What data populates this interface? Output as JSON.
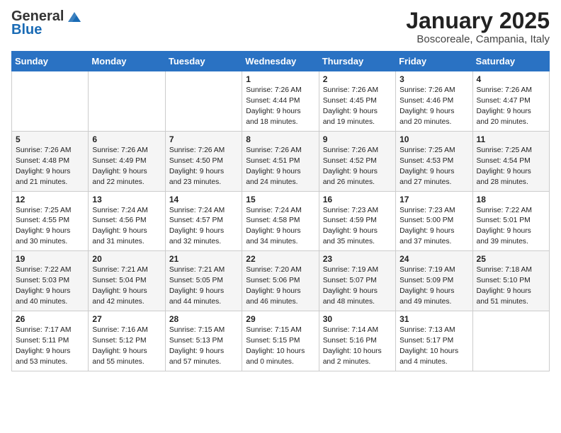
{
  "header": {
    "logo_general": "General",
    "logo_blue": "Blue",
    "month_title": "January 2025",
    "location": "Boscoreale, Campania, Italy"
  },
  "days_of_week": [
    "Sunday",
    "Monday",
    "Tuesday",
    "Wednesday",
    "Thursday",
    "Friday",
    "Saturday"
  ],
  "weeks": [
    [
      {
        "day": "",
        "info": ""
      },
      {
        "day": "",
        "info": ""
      },
      {
        "day": "",
        "info": ""
      },
      {
        "day": "1",
        "info": "Sunrise: 7:26 AM\nSunset: 4:44 PM\nDaylight: 9 hours\nand 18 minutes."
      },
      {
        "day": "2",
        "info": "Sunrise: 7:26 AM\nSunset: 4:45 PM\nDaylight: 9 hours\nand 19 minutes."
      },
      {
        "day": "3",
        "info": "Sunrise: 7:26 AM\nSunset: 4:46 PM\nDaylight: 9 hours\nand 20 minutes."
      },
      {
        "day": "4",
        "info": "Sunrise: 7:26 AM\nSunset: 4:47 PM\nDaylight: 9 hours\nand 20 minutes."
      }
    ],
    [
      {
        "day": "5",
        "info": "Sunrise: 7:26 AM\nSunset: 4:48 PM\nDaylight: 9 hours\nand 21 minutes."
      },
      {
        "day": "6",
        "info": "Sunrise: 7:26 AM\nSunset: 4:49 PM\nDaylight: 9 hours\nand 22 minutes."
      },
      {
        "day": "7",
        "info": "Sunrise: 7:26 AM\nSunset: 4:50 PM\nDaylight: 9 hours\nand 23 minutes."
      },
      {
        "day": "8",
        "info": "Sunrise: 7:26 AM\nSunset: 4:51 PM\nDaylight: 9 hours\nand 24 minutes."
      },
      {
        "day": "9",
        "info": "Sunrise: 7:26 AM\nSunset: 4:52 PM\nDaylight: 9 hours\nand 26 minutes."
      },
      {
        "day": "10",
        "info": "Sunrise: 7:25 AM\nSunset: 4:53 PM\nDaylight: 9 hours\nand 27 minutes."
      },
      {
        "day": "11",
        "info": "Sunrise: 7:25 AM\nSunset: 4:54 PM\nDaylight: 9 hours\nand 28 minutes."
      }
    ],
    [
      {
        "day": "12",
        "info": "Sunrise: 7:25 AM\nSunset: 4:55 PM\nDaylight: 9 hours\nand 30 minutes."
      },
      {
        "day": "13",
        "info": "Sunrise: 7:24 AM\nSunset: 4:56 PM\nDaylight: 9 hours\nand 31 minutes."
      },
      {
        "day": "14",
        "info": "Sunrise: 7:24 AM\nSunset: 4:57 PM\nDaylight: 9 hours\nand 32 minutes."
      },
      {
        "day": "15",
        "info": "Sunrise: 7:24 AM\nSunset: 4:58 PM\nDaylight: 9 hours\nand 34 minutes."
      },
      {
        "day": "16",
        "info": "Sunrise: 7:23 AM\nSunset: 4:59 PM\nDaylight: 9 hours\nand 35 minutes."
      },
      {
        "day": "17",
        "info": "Sunrise: 7:23 AM\nSunset: 5:00 PM\nDaylight: 9 hours\nand 37 minutes."
      },
      {
        "day": "18",
        "info": "Sunrise: 7:22 AM\nSunset: 5:01 PM\nDaylight: 9 hours\nand 39 minutes."
      }
    ],
    [
      {
        "day": "19",
        "info": "Sunrise: 7:22 AM\nSunset: 5:03 PM\nDaylight: 9 hours\nand 40 minutes."
      },
      {
        "day": "20",
        "info": "Sunrise: 7:21 AM\nSunset: 5:04 PM\nDaylight: 9 hours\nand 42 minutes."
      },
      {
        "day": "21",
        "info": "Sunrise: 7:21 AM\nSunset: 5:05 PM\nDaylight: 9 hours\nand 44 minutes."
      },
      {
        "day": "22",
        "info": "Sunrise: 7:20 AM\nSunset: 5:06 PM\nDaylight: 9 hours\nand 46 minutes."
      },
      {
        "day": "23",
        "info": "Sunrise: 7:19 AM\nSunset: 5:07 PM\nDaylight: 9 hours\nand 48 minutes."
      },
      {
        "day": "24",
        "info": "Sunrise: 7:19 AM\nSunset: 5:09 PM\nDaylight: 9 hours\nand 49 minutes."
      },
      {
        "day": "25",
        "info": "Sunrise: 7:18 AM\nSunset: 5:10 PM\nDaylight: 9 hours\nand 51 minutes."
      }
    ],
    [
      {
        "day": "26",
        "info": "Sunrise: 7:17 AM\nSunset: 5:11 PM\nDaylight: 9 hours\nand 53 minutes."
      },
      {
        "day": "27",
        "info": "Sunrise: 7:16 AM\nSunset: 5:12 PM\nDaylight: 9 hours\nand 55 minutes."
      },
      {
        "day": "28",
        "info": "Sunrise: 7:15 AM\nSunset: 5:13 PM\nDaylight: 9 hours\nand 57 minutes."
      },
      {
        "day": "29",
        "info": "Sunrise: 7:15 AM\nSunset: 5:15 PM\nDaylight: 10 hours\nand 0 minutes."
      },
      {
        "day": "30",
        "info": "Sunrise: 7:14 AM\nSunset: 5:16 PM\nDaylight: 10 hours\nand 2 minutes."
      },
      {
        "day": "31",
        "info": "Sunrise: 7:13 AM\nSunset: 5:17 PM\nDaylight: 10 hours\nand 4 minutes."
      },
      {
        "day": "",
        "info": ""
      }
    ]
  ]
}
